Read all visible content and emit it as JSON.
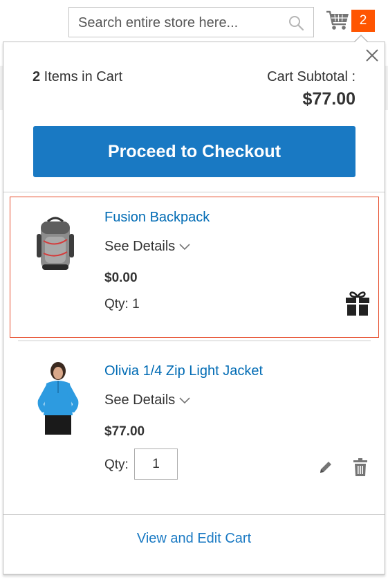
{
  "header": {
    "search_placeholder": "Search entire store here...",
    "cart_count": "2"
  },
  "minicart": {
    "items_count": "2",
    "items_label": " Items in Cart",
    "subtotal_label": "Cart Subtotal :",
    "subtotal_value": "$77.00",
    "checkout_label": "Proceed to Checkout",
    "view_cart_label": "View and Edit Cart",
    "items": [
      {
        "name": "Fusion Backpack",
        "details_label": "See Details",
        "price": "$0.00",
        "qty_label": "Qty: 1"
      },
      {
        "name": "Olivia 1/4 Zip Light Jacket",
        "details_label": "See Details",
        "price": "$77.00",
        "qty_label": "Qty:",
        "qty_value": "1"
      }
    ]
  },
  "colors": {
    "primary_button": "#1979c3",
    "link": "#006bb4",
    "cart_badge": "#ff5501",
    "highlight_border": "#e64a28"
  },
  "icons": [
    "search-icon",
    "cart-icon",
    "close-icon",
    "chevron-down-icon",
    "gift-icon",
    "edit-pencil-icon",
    "trash-icon"
  ]
}
